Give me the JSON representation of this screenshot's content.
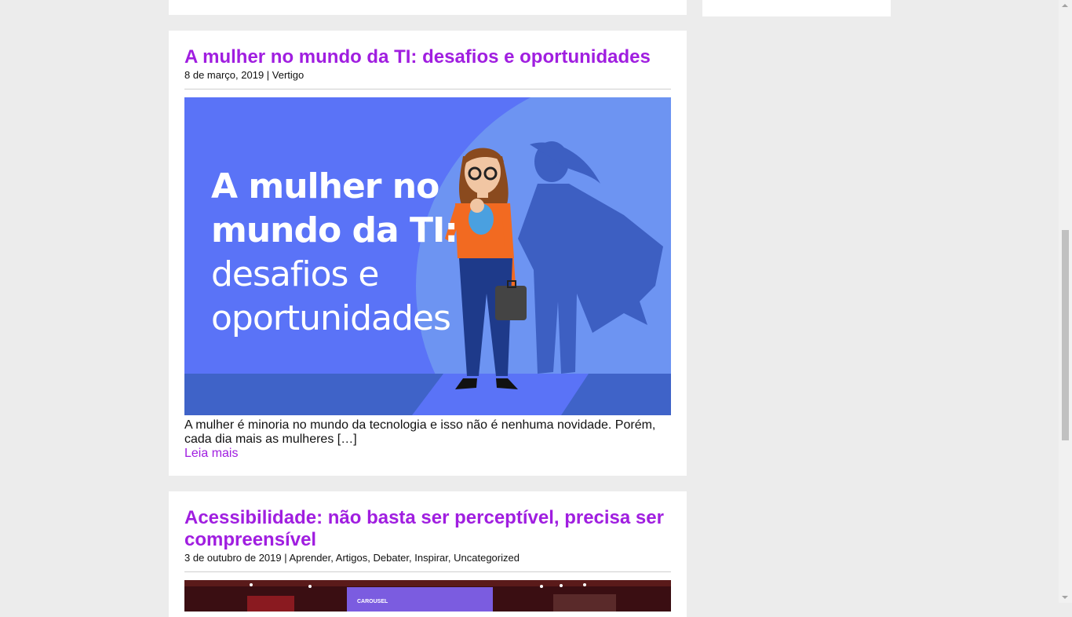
{
  "posts": [
    {
      "title": "A mulher no mundo da TI: desafios e oportunidades",
      "date": "8 de março, 2019",
      "separator": " | ",
      "categories": [
        "Vertigo"
      ],
      "image": {
        "line1": "A mulher no",
        "line2": "mundo da TI:",
        "line3": "desafios e",
        "line4": "oportunidades"
      },
      "excerpt": "A mulher é minoria no mundo da tecnologia e isso não é nenhuma novidade. Porém, cada dia mais as mulheres […]",
      "read_more": "Leia mais"
    },
    {
      "title": "Acessibilidade: não basta ser perceptível, precisa ser compreensível",
      "date": "3 de outubro de 2019",
      "separator": " | ",
      "categories": [
        "Aprender",
        "Artigos",
        "Debater",
        "Inspirar",
        "Uncategorized"
      ],
      "image_caption": "CAROUSEL"
    }
  ],
  "colors": {
    "accent": "#a01ee0",
    "background": "#ececec",
    "hero_blue": "#5a73f7"
  }
}
